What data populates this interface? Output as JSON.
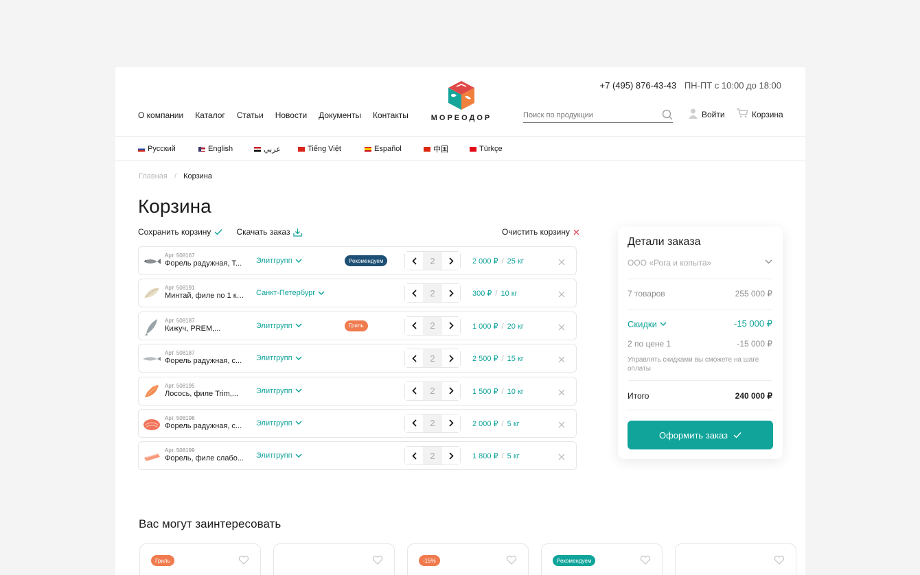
{
  "header": {
    "phone": "+7 (495) 876-43-43",
    "hours": "ПН-ПТ с 10:00 до 18:00",
    "nav": [
      "О компании",
      "Каталог",
      "Статьи",
      "Новости",
      "Документы",
      "Контакты"
    ],
    "logo_text": "МОРЕОДОР",
    "search_placeholder": "Поиск по продукции",
    "login_label": "Войти",
    "cart_label": "Корзина"
  },
  "languages": [
    {
      "label": "Русский",
      "flag": "ru"
    },
    {
      "label": "English",
      "flag": "us"
    },
    {
      "label": "عربي",
      "flag": "eg"
    },
    {
      "label": "Tiếng Việt",
      "flag": "vn"
    },
    {
      "label": "Español",
      "flag": "es"
    },
    {
      "label": "中国",
      "flag": "cn"
    },
    {
      "label": "Türkçe",
      "flag": "tr"
    }
  ],
  "breadcrumb": {
    "home": "Главная",
    "separator": "/",
    "current": "Корзина"
  },
  "page_title": "Корзина",
  "actions": {
    "save": "Сохранить корзину",
    "download": "Скачать заказ",
    "clear": "Очистить корзину"
  },
  "cart_items": [
    {
      "art": "Арт. 508167",
      "name": "Форель радужная, Т...",
      "supplier": "Элитгрупп",
      "badge": "Рекомендуем",
      "badge_type": "rec",
      "qty": "2",
      "price": "2 000 ₽",
      "weight": "25 кг",
      "img": "fish"
    },
    {
      "art": "Арт. 508191",
      "name": "Минтай, филе по 1 кг,...",
      "supplier": "Санкт-Петербург",
      "badge": "",
      "badge_type": "",
      "qty": "2",
      "price": "300 ₽",
      "weight": "10 кг",
      "img": "fillet-white"
    },
    {
      "art": "Арт. 508187",
      "name": "Кижуч, PREM,...",
      "supplier": "Элитгрупп",
      "badge": "Гриль",
      "badge_type": "grill",
      "qty": "2",
      "price": "1 000 ₽",
      "weight": "20 кг",
      "img": "fish-vertical"
    },
    {
      "art": "Арт. 508187",
      "name": "Форель радужная, с...",
      "supplier": "Элитгрупп",
      "badge": "",
      "badge_type": "",
      "qty": "2",
      "price": "2 500 ₽",
      "weight": "15 кг",
      "img": "fish-silver"
    },
    {
      "art": "Арт. 508195",
      "name": "Лосось, филе Trim,...",
      "supplier": "Элитгрупп",
      "badge": "",
      "badge_type": "",
      "qty": "2",
      "price": "1 500 ₽",
      "weight": "10 кг",
      "img": "fillet-orange"
    },
    {
      "art": "Арт. 508198",
      "name": "Форель радужная, с...",
      "supplier": "Элитгрупп",
      "badge": "",
      "badge_type": "",
      "qty": "2",
      "price": "2 000 ₽",
      "weight": "5 кг",
      "img": "steak"
    },
    {
      "art": "Арт. 508199",
      "name": "Форель, филе слабо...",
      "supplier": "Элитгрупп",
      "badge": "",
      "badge_type": "",
      "qty": "2",
      "price": "1 800 ₽",
      "weight": "5 кг",
      "img": "fillet-pink"
    }
  ],
  "order": {
    "title": "Детали заказа",
    "company": "ООО «Рога и копыта»",
    "items_count": "7 товаров",
    "items_sum": "255 000 ₽",
    "discounts_label": "Скидки",
    "discounts_value": "-15 000 ₽",
    "promo_label": "2 по цене 1",
    "promo_value": "-15 000 ₽",
    "note": "Управлять скидками вы сможете на шаге оплаты",
    "total_label": "Итого",
    "total_value": "240 000 ₽",
    "checkout_label": "Оформить заказ"
  },
  "recommendations": {
    "title": "Вас могут заинтересовать",
    "cards": [
      {
        "badge": "Гриль",
        "badge_color": "orange"
      },
      {
        "badge": "",
        "badge_color": ""
      },
      {
        "badge": "-15%",
        "badge_color": "orange"
      },
      {
        "badge": "Рекомендуем",
        "badge_color": "teal"
      },
      {
        "badge": "",
        "badge_color": ""
      }
    ]
  },
  "colors": {
    "accent": "#10a49a",
    "badge_recommend": "#1e4f74",
    "badge_grill": "#f07b4e"
  }
}
